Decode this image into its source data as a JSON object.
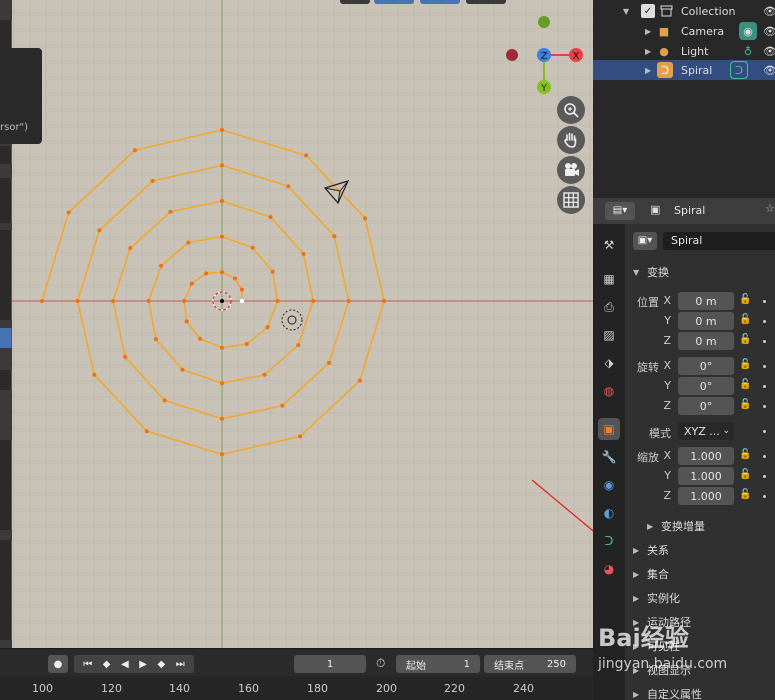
{
  "viewport": {
    "popup_text": "rsor\")",
    "gizmo": {
      "z_label": "Z",
      "x_label": "X",
      "y_label": "Y"
    }
  },
  "outliner": {
    "rows": [
      {
        "label": "Collection"
      },
      {
        "label": "Camera"
      },
      {
        "label": "Light"
      },
      {
        "label": "Spiral"
      }
    ]
  },
  "properties": {
    "header_object": "Spiral",
    "object_name": "Spiral",
    "transform_title": "变换",
    "location": {
      "label": "位置",
      "x": "0 m",
      "y": "0 m",
      "z": "0 m"
    },
    "rotation": {
      "label": "旋转",
      "x": "0°",
      "y": "0°",
      "z": "0°"
    },
    "mode": {
      "label": "模式",
      "value": "XYZ ..."
    },
    "scale": {
      "label": "缩放",
      "x": "1.000",
      "y": "1.000",
      "z": "1.000"
    },
    "axis": {
      "x": "X",
      "y": "Y",
      "z": "Z"
    },
    "delta_transform": "变换增量",
    "sections": [
      "关系",
      "集合",
      "实例化",
      "运动路径",
      "可见性",
      "视图显示",
      "自定义属性"
    ]
  },
  "timeline": {
    "current_frame": "1",
    "start_label": "起始",
    "start_value": "1",
    "end_label": "结束点",
    "end_value": "250",
    "ruler": [
      "100",
      "120",
      "140",
      "160",
      "180",
      "200",
      "220",
      "240"
    ]
  },
  "watermark": {
    "text": "Bai经验",
    "url": "jingyan.baidu.com"
  },
  "colors": {
    "spiral": "#f0a830",
    "selection": "#334d80",
    "viewport_bg": "#c9c2b7",
    "x_axis": "#e8404a",
    "y_axis": "#86c020",
    "z_axis": "#3b82e0"
  }
}
